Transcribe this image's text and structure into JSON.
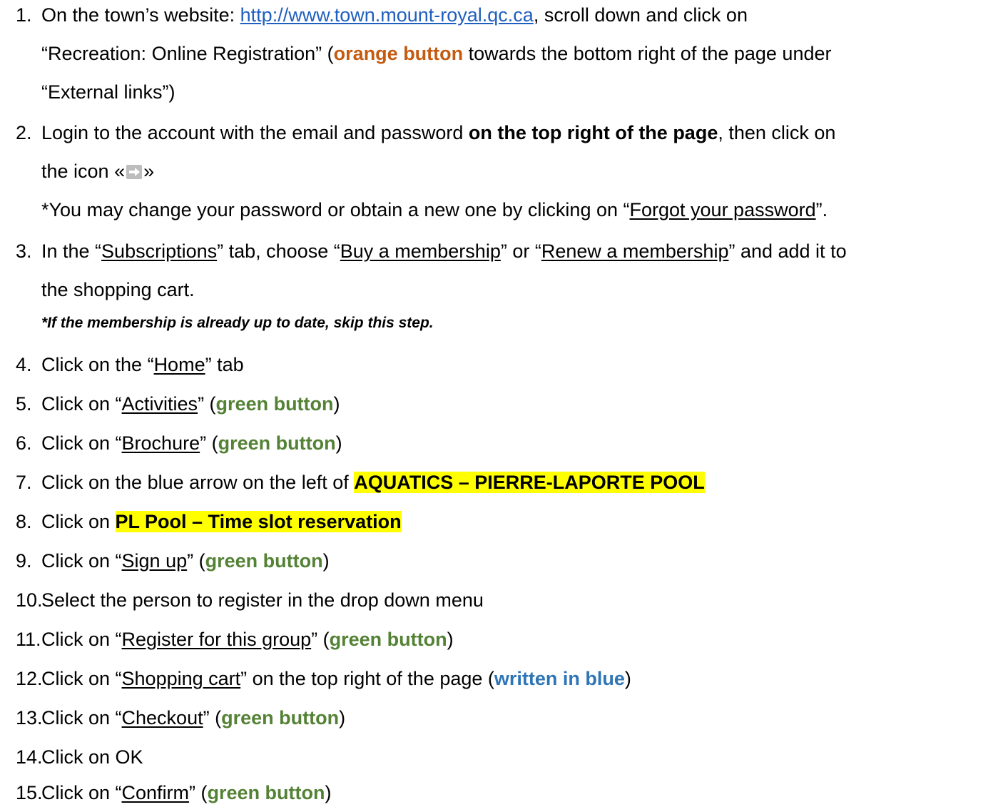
{
  "steps": {
    "s1": {
      "num": "1.",
      "a": "On the town’s website: ",
      "link": "http://www.town.mount-royal.qc.ca",
      "b": ", scroll down and click on",
      "c": "“Recreation: Online Registration” (",
      "orange": "orange button",
      "d": " towards the bottom right of the page under",
      "e": "“External links”)"
    },
    "s2": {
      "num": "2.",
      "a": "Login to the account with the email and password ",
      "bold": "on the top right of the page",
      "b": ", then click on",
      "c": "the icon «",
      "d": "»",
      "e": "*You may change your password or obtain a new one by clicking on “",
      "u": "Forgot your password",
      "f": "”."
    },
    "s3": {
      "num": "3.",
      "a": "In the “",
      "u1": "Subscriptions",
      "b": "” tab, choose “",
      "u2": "Buy a membership",
      "c": "” or “",
      "u3": "Renew a membership",
      "d": "” and add it to",
      "e": "the shopping cart.",
      "note": "*If the membership is already up to date, skip this step."
    },
    "s4": {
      "num": "4.",
      "a": "Click on the “",
      "u": "Home",
      "b": "” tab"
    },
    "s5": {
      "num": "5.",
      "a": "Click on “",
      "u": "Activities",
      "b": "” (",
      "green": "green button",
      "c": ")"
    },
    "s6": {
      "num": "6.",
      "a": "Click on “",
      "u": "Brochure",
      "b": "” (",
      "green": "green button",
      "c": ")"
    },
    "s7": {
      "num": "7.",
      "a": "Click on the blue arrow on the left of ",
      "hl": "AQUATICS – PIERRE-LAPORTE POOL"
    },
    "s8": {
      "num": "8.",
      "a": "Click on ",
      "hl": "PL Pool – Time slot reservation"
    },
    "s9": {
      "num": "9.",
      "a": "Click on “",
      "u": "Sign up",
      "b": "” (",
      "green": "green button",
      "c": ")"
    },
    "s10": {
      "num": "10.",
      "a": "Select the person to register in the drop down menu"
    },
    "s11": {
      "num": "11.",
      "a": "Click on “",
      "u": "Register for this group",
      "b": "” (",
      "green": "green button",
      "c": ")"
    },
    "s12": {
      "num": "12.",
      "a": "Click on “",
      "u": "Shopping cart",
      "b": "” on the top right of the page (",
      "blue": "written in blue",
      "c": ")"
    },
    "s13": {
      "num": "13.",
      "a": "Click on “",
      "u": "Checkout",
      "b": "” (",
      "green": "green button",
      "c": ")"
    },
    "s14": {
      "num": "14.",
      "a": "Click on OK"
    },
    "s15": {
      "num": "15.",
      "a": "Click on “",
      "u": "Confirm",
      "b": "” (",
      "green": "green button",
      "c": ")"
    }
  },
  "colors": {
    "link": "#1f5fbf",
    "orange": "#c55a11",
    "green": "#548235",
    "blue": "#2e75b6",
    "highlight": "#ffff00"
  },
  "icons": [
    "arrow-right-icon"
  ]
}
